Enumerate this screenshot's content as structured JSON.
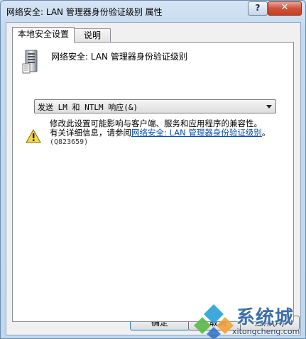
{
  "window": {
    "title": "网络安全: LAN 管理器身份验证级别 属性",
    "help_label": "?",
    "close_label": "✕"
  },
  "tabs": [
    {
      "label": "本地安全设置",
      "active": true
    },
    {
      "label": "说明",
      "active": false
    }
  ],
  "policy": {
    "name": "网络安全: LAN 管理器身份验证级别",
    "icon": "server-icon"
  },
  "select": {
    "value": "发送 LM 和 NTLM 响应(&)"
  },
  "warning": {
    "icon": "warning-icon",
    "line1": "修改此设置可能影响与客户端、服务和应用程序的兼容性。",
    "line2_prefix": "有关详细信息，请参阅",
    "link_text": "网络安全: LAN 管理器身份验证级别",
    "line2_suffix": "。",
    "kb": "(Q823659)"
  },
  "buttons": {
    "ok": "确定",
    "cancel": "取消",
    "apply": "应用(A)"
  },
  "watermark": {
    "text": "系统城",
    "url": "xitongcheng.com"
  }
}
